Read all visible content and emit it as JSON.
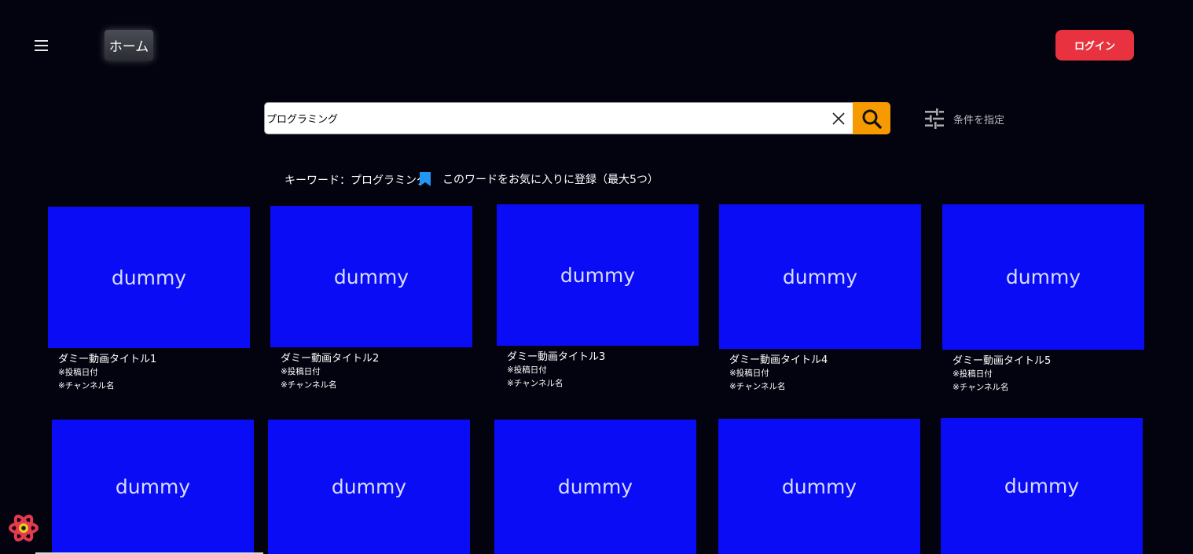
{
  "header": {
    "home_label": "ホーム",
    "login_label": "ログイン"
  },
  "search": {
    "value": "プログラミング",
    "filter_label": "条件を指定"
  },
  "keyword_bar": {
    "keyword_text": "キーワード：プログラミング",
    "favorite_text": "このワードをお気に入りに登録（最大5つ）"
  },
  "colors": {
    "background": "#03030f",
    "thumbnail": "#0a0cf6",
    "login": "#e8323f",
    "search_button": "#f79a00",
    "bookmark": "#2196f3"
  },
  "videos": [
    {
      "thumb": "dummy",
      "title": "ダミー動画タイトル1",
      "date": "※投稿日付",
      "channel": "※チャンネル名"
    },
    {
      "thumb": "dummy",
      "title": "ダミー動画タイトル2",
      "date": "※投稿日付",
      "channel": "※チャンネル名"
    },
    {
      "thumb": "dummy",
      "title": "ダミー動画タイトル3",
      "date": "※投稿日付",
      "channel": "※チャンネル名"
    },
    {
      "thumb": "dummy",
      "title": "ダミー動画タイトル4",
      "date": "※投稿日付",
      "channel": "※チャンネル名"
    },
    {
      "thumb": "dummy",
      "title": "ダミー動画タイトル5",
      "date": "※投稿日付",
      "channel": "※チャンネル名"
    },
    {
      "thumb": "dummy"
    },
    {
      "thumb": "dummy"
    },
    {
      "thumb": "dummy"
    },
    {
      "thumb": "dummy"
    },
    {
      "thumb": "dummy"
    }
  ]
}
